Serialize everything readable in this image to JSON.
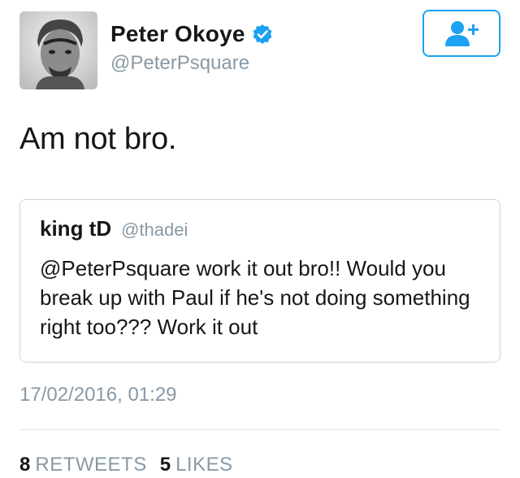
{
  "author": {
    "display_name": "Peter Okoye",
    "handle": "@PeterPsquare",
    "verified": true,
    "avatar_icon": "profile-photo-avatar"
  },
  "follow_button": {
    "icon": "add-user-icon",
    "color": "#1da1f2"
  },
  "tweet": {
    "text": "Am not bro."
  },
  "quoted_tweet": {
    "display_name": "king tD",
    "handle": "@thadei",
    "text": "@PeterPsquare work it out bro!! Would you break up with Paul if he's not doing something right too??? Work it out"
  },
  "timestamp": "17/02/2016, 01:29",
  "stats": {
    "retweets_count": "8",
    "retweets_label": "RETWEETS",
    "likes_count": "5",
    "likes_label": "LIKES"
  },
  "colors": {
    "accent": "#1da1f2",
    "text": "#14171a",
    "muted": "#8899a6",
    "border": "#ccd6dd"
  }
}
